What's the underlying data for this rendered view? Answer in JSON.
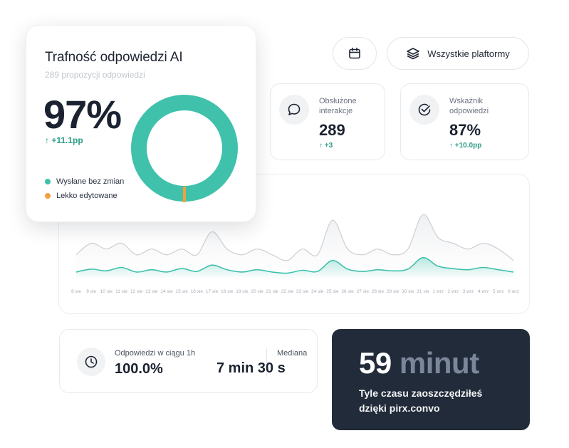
{
  "accuracy": {
    "title": "Trafność odpowiedzi AI",
    "subtitle": "289 propozycji odpowiedzi",
    "value": "97%",
    "delta": "+11.1pp",
    "delta_icon": "arrow-up-icon",
    "legend": [
      {
        "label": "Wysłane bez zmian",
        "color": "#3fc1ac"
      },
      {
        "label": "Lekko edytowane",
        "color": "#f2a03d"
      }
    ],
    "donut": {
      "sent_unchanged_percent": 99,
      "lightly_edited_percent": 1,
      "colors": [
        "#3fc1ac",
        "#f2a03d"
      ]
    }
  },
  "filters": {
    "calendar_icon": "calendar-icon",
    "platforms_icon": "layers-icon",
    "platforms_label": "Wszystkie plaftormy"
  },
  "stats": {
    "interactions": {
      "icon": "chat-bubble-icon",
      "label": "Obsłużone interakcje",
      "value": "289",
      "delta": "+3"
    },
    "ratio": {
      "icon": "check-circle-icon",
      "label": "Wskaźnik odpowiedzi",
      "value": "87%",
      "delta": "+10.0pp"
    }
  },
  "response": {
    "icon": "clock-icon",
    "within_label": "Odpowiedzi w ciągu 1h",
    "within_value": "100.0%",
    "median_label": "Mediana",
    "median_value": "7 min 30 s"
  },
  "saved": {
    "number": "59",
    "unit": "minut",
    "caption_line1": "Tyle czasu zaoszczędziłeś",
    "caption_line2": "dzięki pirx.convo"
  },
  "chart_data": {
    "type": "area",
    "x": [
      "8 sie",
      "9 sie",
      "10 sie",
      "11 sie",
      "12 sie",
      "13 sie",
      "14 sie",
      "15 sie",
      "16 sie",
      "17 sie",
      "18 sie",
      "19 sie",
      "20 sie",
      "21 sie",
      "22 sie",
      "23 sie",
      "24 sie",
      "25 sie",
      "26 sie",
      "27 sie",
      "28 sie",
      "29 sie",
      "30 sie",
      "31 sie",
      "1 wrz",
      "2 wrz",
      "3 wrz",
      "4 wrz",
      "5 wrz",
      "6 wrz"
    ],
    "series": [
      {
        "color": "#cfd2d6",
        "values": [
          4,
          6,
          5,
          6,
          4,
          5,
          4,
          5,
          4,
          8,
          5,
          4,
          5,
          4,
          3,
          5,
          4,
          10,
          5,
          4,
          5,
          4,
          5,
          11,
          7,
          6,
          5,
          6,
          5,
          3
        ]
      },
      {
        "color": "#3fc1ac",
        "values": [
          1,
          1.5,
          1.2,
          1.8,
          1,
          1.4,
          1,
          1.6,
          1.1,
          2.2,
          1.4,
          1,
          1.4,
          1,
          0.8,
          1.3,
          1.1,
          3,
          1.5,
          1.1,
          1.4,
          1.2,
          1.5,
          3.5,
          2,
          1.6,
          1.4,
          1.8,
          1.4,
          1
        ]
      }
    ],
    "ylim": [
      0,
      13
    ],
    "grid": false
  }
}
